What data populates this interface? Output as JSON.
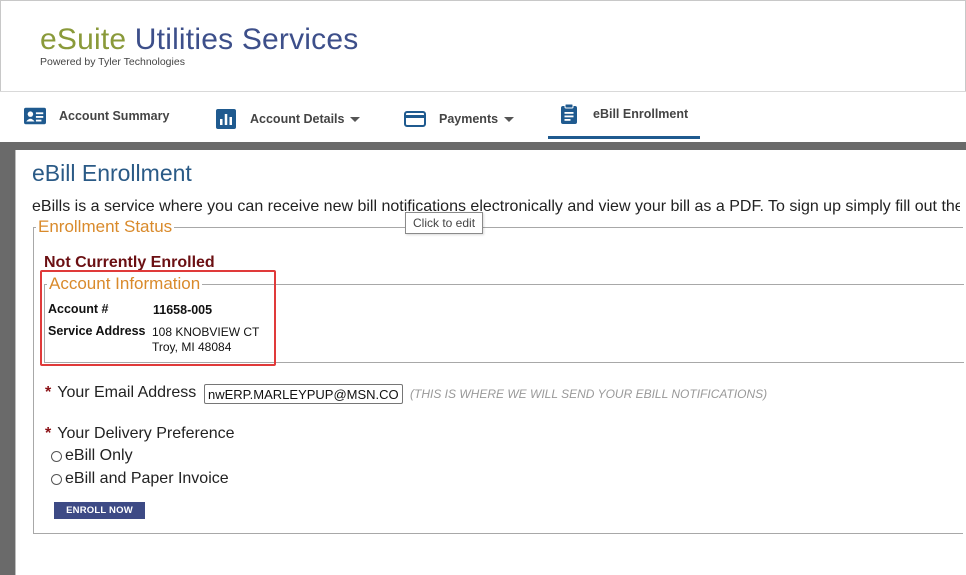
{
  "brand": {
    "title_part1": "eSuite",
    "title_part2": " Utilities Services",
    "subtitle": "Powered by Tyler Technologies"
  },
  "nav": {
    "items": [
      {
        "label": "Account Summary",
        "icon": "id-card-icon"
      },
      {
        "label": "Account Details",
        "icon": "bar-chart-icon"
      },
      {
        "label": "Payments",
        "icon": "credit-card-icon"
      },
      {
        "label": "eBill Enrollment",
        "icon": "clipboard-icon"
      }
    ],
    "active": "eBill Enrollment"
  },
  "page": {
    "title": "eBill Enrollment",
    "intro": "eBills is a service where you can receive new bill notifications electronically and view your bill as a PDF. To sign up simply fill out the",
    "tooltip": "Click to edit"
  },
  "enrollment": {
    "legend": "Enrollment Status",
    "status": "Not Currently Enrolled"
  },
  "account": {
    "legend": "Account Information",
    "account_label": "Account #",
    "account_value": "11658-005",
    "address_label": "Service Address",
    "address_line1": "108 KNOBVIEW CT",
    "address_line2": "Troy, MI 48084"
  },
  "form": {
    "required_mark": "*",
    "email_label": "Your Email Address",
    "email_value": "nwERP.MARLEYPUP@MSN.COM",
    "email_hint": "(THIS IS WHERE WE WILL SEND YOUR EBILL NOTIFICATIONS)",
    "delivery_label": "Your Delivery Preference",
    "options": [
      "eBill Only",
      "eBill and Paper Invoice"
    ],
    "submit_label": "ENROLL NOW"
  },
  "colors": {
    "brand_green": "#8a9a3a",
    "brand_blue": "#3d4f8a",
    "title_blue": "#2a5a86",
    "legend_orange": "#d98a2b",
    "status_red": "#6b0f12",
    "highlight_red": "#e03a3a",
    "button_navy": "#3d4a85"
  }
}
